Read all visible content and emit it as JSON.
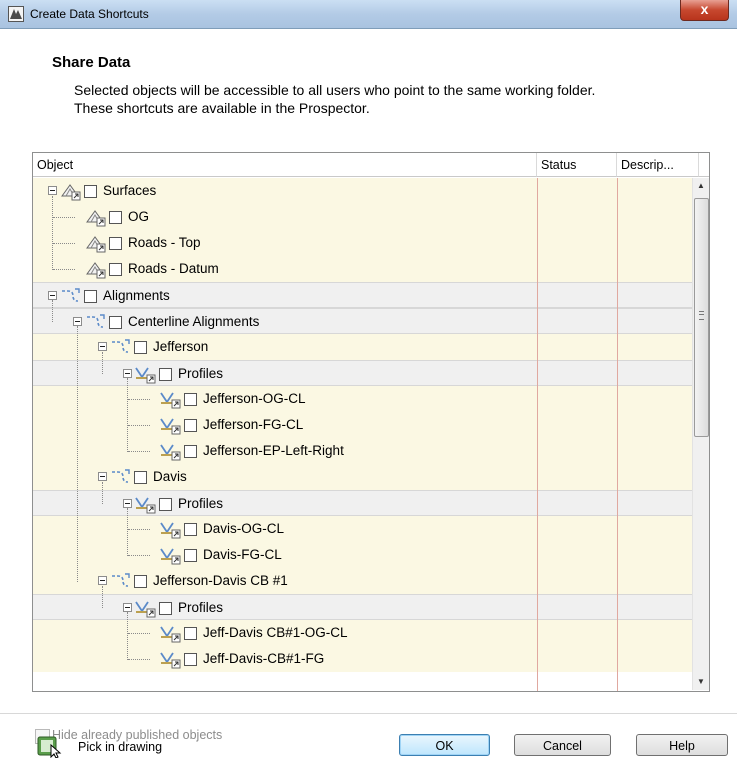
{
  "window": {
    "title": "Create Data Shortcuts",
    "close_label": "x"
  },
  "header": {
    "title": "Share Data",
    "description_line1": "Selected objects will be accessible to all users who point to the same working folder.",
    "description_line2": "These shortcuts are available in the Prospector."
  },
  "columns": {
    "object": "Object",
    "status": "Status",
    "description": "Descrip..."
  },
  "tree": [
    {
      "label": "Surfaces",
      "icon": "surface-icon",
      "checked": false
    },
    {
      "label": "OG",
      "icon": "surface-icon",
      "checked": false
    },
    {
      "label": "Roads - Top",
      "icon": "surface-icon",
      "checked": false
    },
    {
      "label": "Roads - Datum",
      "icon": "surface-icon",
      "checked": false
    },
    {
      "label": "Alignments",
      "icon": "alignment-icon",
      "checked": false
    },
    {
      "label": "Centerline Alignments",
      "icon": "alignment-icon",
      "checked": false
    },
    {
      "label": "Jefferson",
      "icon": "alignment-icon",
      "checked": false
    },
    {
      "label": "Profiles",
      "icon": "profile-icon",
      "checked": false
    },
    {
      "label": "Jefferson-OG-CL",
      "icon": "profile-icon",
      "checked": false
    },
    {
      "label": "Jefferson-FG-CL",
      "icon": "profile-icon",
      "checked": false
    },
    {
      "label": "Jefferson-EP-Left-Right",
      "icon": "profile-icon",
      "checked": false
    },
    {
      "label": "Davis",
      "icon": "alignment-icon",
      "checked": false
    },
    {
      "label": "Profiles",
      "icon": "profile-icon",
      "checked": false
    },
    {
      "label": "Davis-OG-CL",
      "icon": "profile-icon",
      "checked": false
    },
    {
      "label": "Davis-FG-CL",
      "icon": "profile-icon",
      "checked": false
    },
    {
      "label": "Jefferson-Davis CB #1",
      "icon": "alignment-icon",
      "checked": false
    },
    {
      "label": "Profiles",
      "icon": "profile-icon",
      "checked": false
    },
    {
      "label": "Jeff-Davis CB#1-OG-CL",
      "icon": "profile-icon",
      "checked": false
    },
    {
      "label": "Jeff-Davis-CB#1-FG",
      "icon": "profile-icon",
      "checked": false
    }
  ],
  "options": {
    "hide_published_label": "Hide already published objects",
    "hide_published_checked": false
  },
  "buttons": {
    "pick": "Pick in drawing",
    "ok": "OK",
    "cancel": "Cancel",
    "help": "Help"
  },
  "colors": {
    "accent": "#3c7fb1",
    "row_alt": "#fbf8e3",
    "close": "#c7482f"
  }
}
